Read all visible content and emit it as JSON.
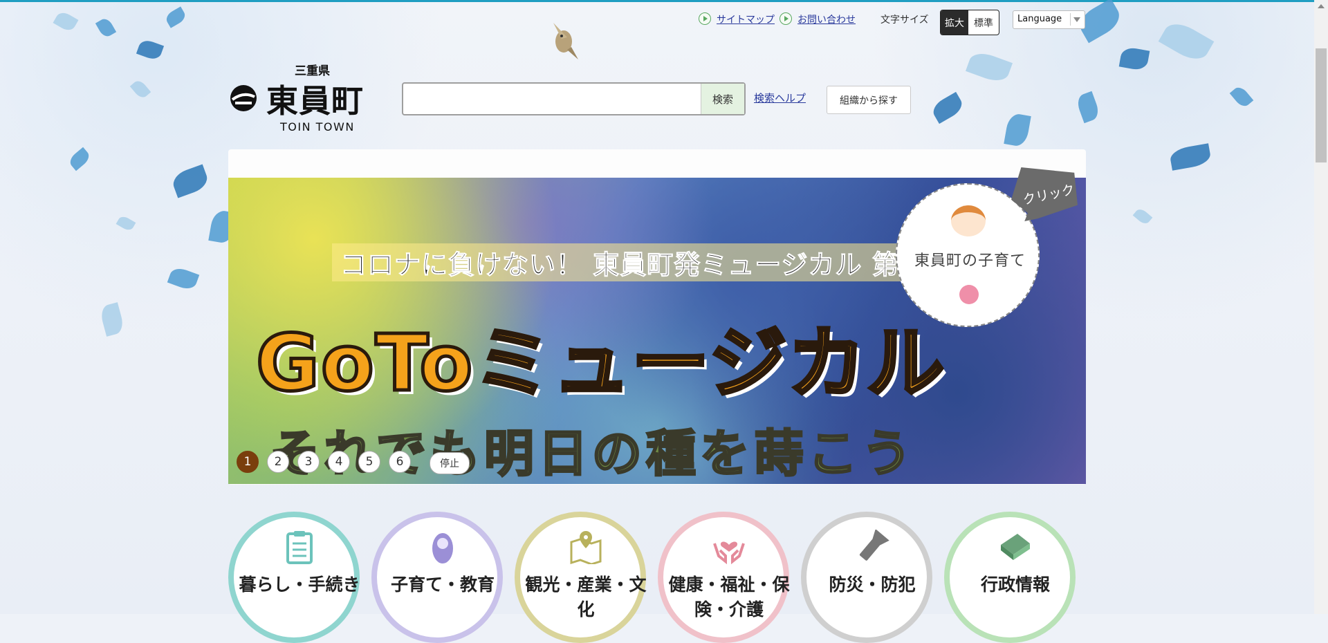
{
  "util": {
    "sitemap": "サイトマップ",
    "contact": "お問い合わせ",
    "fontsize_label": "文字サイズ",
    "fontsize_large": "拡大",
    "fontsize_standard": "標準",
    "language": "Language"
  },
  "logo": {
    "prefecture": "三重県",
    "name": "東員町",
    "english": "TOIN TOWN"
  },
  "search": {
    "button": "検索",
    "help": "検索ヘルプ",
    "org_button": "組織から探す"
  },
  "banner": {
    "subtitle": "コロナに負けない！ 東員町発ミュージカル 第",
    "title": "GoToミュージカル",
    "bottom": "それでも明日の種を蒔こう",
    "badge_text": "東員町の子育て",
    "click_label": "クリック",
    "slides": [
      "1",
      "2",
      "3",
      "4",
      "5",
      "6"
    ],
    "stop_label": "停止"
  },
  "categories": [
    {
      "label": "暮らし・手続き",
      "icon": "clipboard-icon",
      "color": "#8fd5cf"
    },
    {
      "label": "子育て・教育",
      "icon": "baby-icon",
      "color": "#c9c2ea"
    },
    {
      "label": "観光・産業・文化",
      "icon": "map-icon",
      "color": "#d9d49a"
    },
    {
      "label": "健康・福祉・保険・介護",
      "icon": "heart-hands-icon",
      "color": "#f0c1c9"
    },
    {
      "label": "防災・防犯",
      "icon": "flashlight-icon",
      "color": "#cfcfcf"
    },
    {
      "label": "行政情報",
      "icon": "book-icon",
      "color": "#b9e2b7"
    }
  ]
}
